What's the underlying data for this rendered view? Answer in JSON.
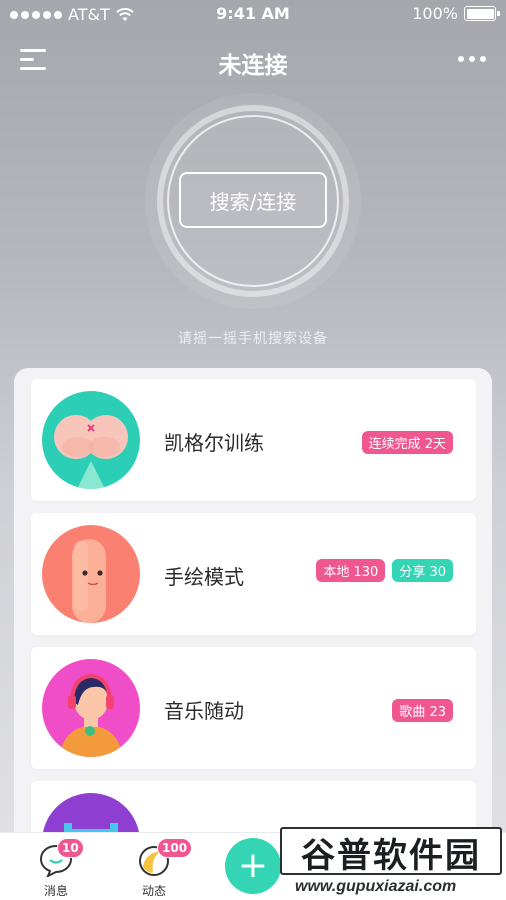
{
  "status_bar": {
    "carrier": "AT&T",
    "time": "9:41 AM",
    "battery": "100%"
  },
  "nav": {
    "title": "未连接"
  },
  "connect": {
    "button_label": "搜索/连接",
    "hint": "请摇一摇手机搜索设备"
  },
  "cards": [
    {
      "title": "凯格尔训练",
      "tags": [
        {
          "text": "连续完成  2天",
          "color": "pink"
        }
      ]
    },
    {
      "title": "手绘模式",
      "tags": [
        {
          "text": "本地 130",
          "color": "pink"
        },
        {
          "text": "分享 30",
          "color": "teal"
        }
      ]
    },
    {
      "title": "音乐随动",
      "tags": [
        {
          "text": "歌曲 23",
          "color": "pink"
        }
      ]
    }
  ],
  "tabbar": {
    "messages": {
      "label": "消息",
      "badge": "10"
    },
    "feed": {
      "label": "动态",
      "badge": "100"
    },
    "plus_label": "+"
  },
  "watermark": {
    "title": "谷普软件园",
    "url": "www.gupuxiazai.com"
  },
  "colors": {
    "pink": "#f0568f",
    "teal": "#33d5b5"
  }
}
